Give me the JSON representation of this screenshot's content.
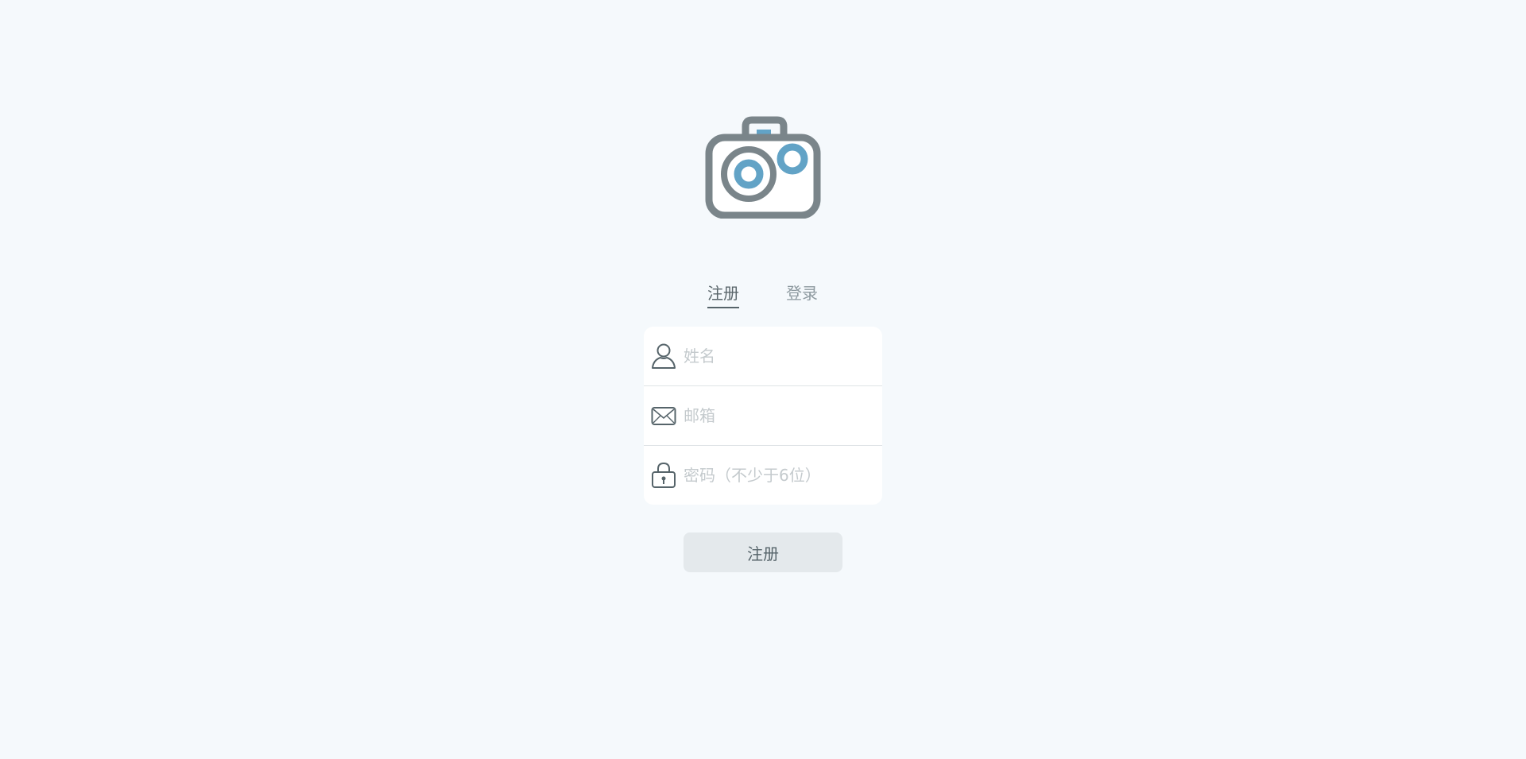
{
  "tabs": {
    "register_label": "注册",
    "login_label": "登录",
    "active": "register"
  },
  "form": {
    "name": {
      "placeholder": "姓名",
      "value": "",
      "icon": "user-icon"
    },
    "email": {
      "placeholder": "邮箱",
      "value": "",
      "icon": "envelope-icon"
    },
    "password": {
      "placeholder": "密码（不少于6位）",
      "value": "",
      "icon": "lock-icon"
    }
  },
  "submit": {
    "label": "注册"
  },
  "logo": {
    "icon": "camera-icon"
  },
  "colors": {
    "background": "#f5f9fc",
    "logo_body": "#7a858a",
    "logo_accent": "#62a3c6",
    "button_bg": "#e4e9ec",
    "text_dark": "#56646a",
    "placeholder": "#c4cacd"
  }
}
